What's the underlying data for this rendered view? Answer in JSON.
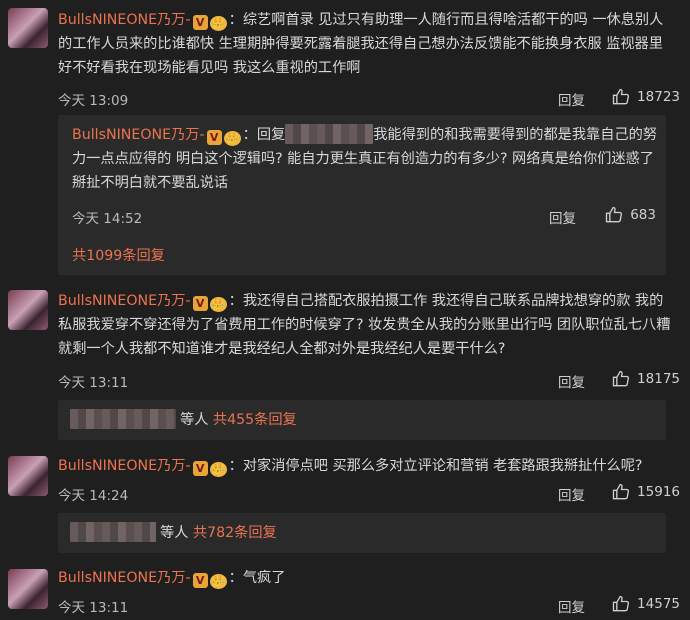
{
  "comments": [
    {
      "username": "BullsNINEONE乃万-",
      "vip_badge": "V",
      "crown_badge": "👑",
      "content": "：综艺啊首录 见过只有助理一人随行而且得啥活都干的吗 一休息别人的工作人员来的比谁都快 生理期肿得要死露着腿我还得自己想办法反馈能不能换身衣服 监视器里好不好看我在现场能看见吗 我这么重视的工作啊",
      "time": "今天 13:09",
      "reply_label": "回复",
      "likes": "18723"
    },
    {
      "username": "BullsNINEONE乃万-",
      "vip_badge": "V",
      "crown_badge": "👑",
      "content": "：我还得自己搭配衣服拍摄工作 我还得自己联系品牌找想穿的款 我的私服我爱穿不穿还得为了省费用工作的时候穿了? 妆发贵全从我的分账里出行吗 团队职位乱七八糟就剩一个人我都不知道谁才是我经纪人全都对外是我经纪人是要干什么?",
      "time": "今天 13:11",
      "reply_label": "回复",
      "likes": "18175"
    },
    {
      "username": "BullsNINEONE乃万-",
      "vip_badge": "V",
      "crown_badge": "👑",
      "content": "：对家消停点吧 买那么多对立评论和营销 老套路跟我掰扯什么呢?",
      "time": "今天 14:24",
      "reply_label": "回复",
      "likes": "15916"
    },
    {
      "username": "BullsNINEONE乃万-",
      "vip_badge": "V",
      "crown_badge": "👑",
      "content": "：气疯了",
      "time": "今天 13:11",
      "reply_label": "回复",
      "likes": "14575"
    }
  ],
  "nested_reply": {
    "username": "BullsNINEONE乃万-",
    "vip_badge": "V",
    "crown_badge": "👑",
    "reply_prefix": "：回复",
    "content": "我能得到的和我需要得到的都是我靠自己的努力一点点应得的 明白这个逻辑吗? 能自力更生真正有创造力的有多少? 网络真是给你们迷惑了 掰扯不明白就不要乱说话",
    "time": "今天 14:52",
    "reply_label": "回复",
    "likes": "683",
    "more_replies": "共1099条回复"
  },
  "reply_summaries": [
    {
      "others": "等人",
      "count": "共455条回复"
    },
    {
      "others": "等人",
      "count": "共782条回复"
    }
  ]
}
